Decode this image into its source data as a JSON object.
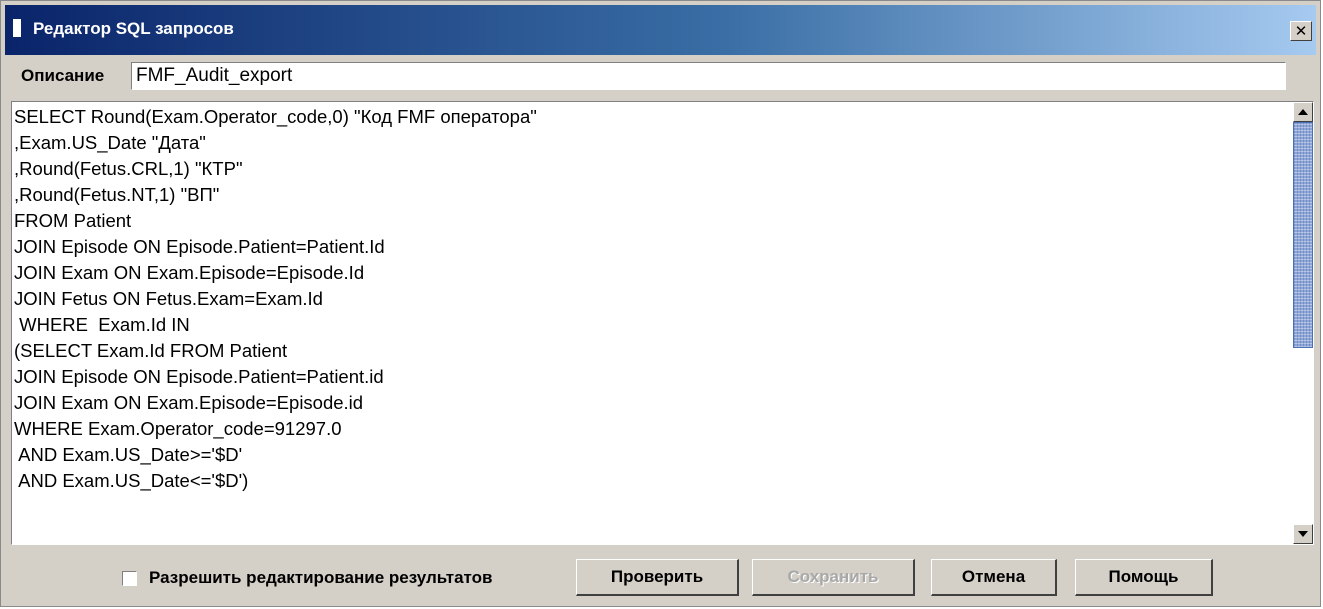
{
  "window": {
    "title": "Редактор SQL запросов",
    "close_glyph": "✕"
  },
  "description": {
    "label": "Описание",
    "value": "FMF_Audit_export"
  },
  "editor": {
    "sql_text": "SELECT Round(Exam.Operator_code,0) \"Код FMF оператора\"\n,Exam.US_Date \"Дата\"\n,Round(Fetus.CRL,1) \"КТР\"\n,Round(Fetus.NT,1) \"ВП\"\nFROM Patient\nJOIN Episode ON Episode.Patient=Patient.Id\nJOIN Exam ON Exam.Episode=Episode.Id\nJOIN Fetus ON Fetus.Exam=Exam.Id\n WHERE  Exam.Id IN\n(SELECT Exam.Id FROM Patient\nJOIN Episode ON Episode.Patient=Patient.id\nJOIN Exam ON Exam.Episode=Episode.id\nWHERE Exam.Operator_code=91297.0\n AND Exam.US_Date>='$D'\n AND Exam.US_Date<='$D')"
  },
  "footer": {
    "allow_edit_label": "Разрешить редактирование результатов",
    "allow_edit_checked": false,
    "check_button": "Проверить",
    "save_button": "Сохранить",
    "save_enabled": false,
    "cancel_button": "Отмена",
    "help_button": "Помощь"
  },
  "colors": {
    "titlebar_start": "#0a246a",
    "titlebar_end": "#a6caf0",
    "window_bg": "#d4d0c8",
    "disabled_text": "#a8a8a8"
  }
}
